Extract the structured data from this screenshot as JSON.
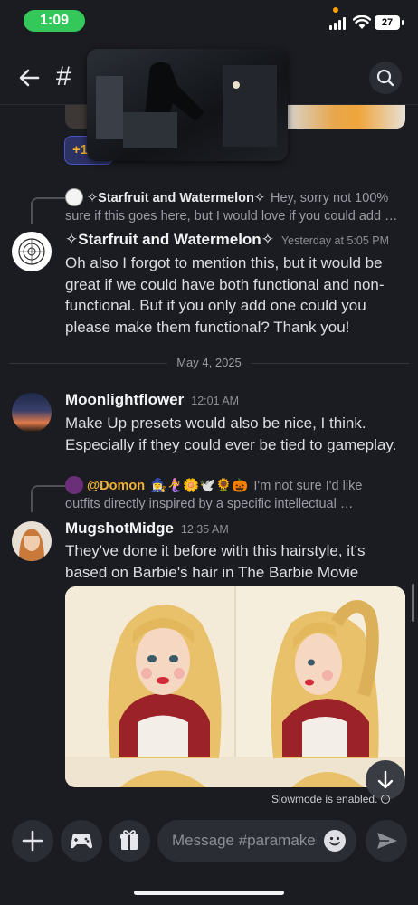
{
  "status_bar": {
    "time": "1:09",
    "battery": "27"
  },
  "header": {
    "hash": "#"
  },
  "reaction": {
    "label": "+1"
  },
  "messages": [
    {
      "reply": {
        "author": "✧Starfruit and Watermelon✧",
        "text_line1": "Hey, sorry not 100%",
        "text_line2": "sure if this goes here, but I would love if you could add …"
      },
      "author": "✧Starfruit and Watermelon✧",
      "timestamp": "Yesterday at 5:05 PM",
      "text": "Oh also I forgot to mention this, but it would be great if we could have both functional and non-functional. But if you only add one could you please make them functional? Thank you!"
    },
    {
      "author": "Moonlightflower",
      "timestamp": "12:01 AM",
      "text": "Make Up presets would also be nice, I think. Especially if they could ever be tied to gameplay."
    },
    {
      "reply": {
        "author": "@Domon",
        "emojis": "🧙‍♀️🧜‍♀️🌼🕊️🌻🎃",
        "text_line1": "I'm not sure I'd like",
        "text_line2": "outfits directly inspired by a specific intellectual …"
      },
      "author": "MugshotMidge",
      "timestamp": "12:35 AM",
      "text": "They've done it before with this hairstyle, it's based on Barbie's hair in The Barbie Movie"
    }
  ],
  "date_divider": "May 4, 2025",
  "slowmode": "Slowmode is enabled.",
  "composer": {
    "placeholder": "Message #paramaker"
  },
  "colors": {
    "status_green": "#34c759",
    "reply_orange": "#f0b232",
    "background": "#1b1c21"
  },
  "icons": [
    "back-arrow-icon",
    "hash-icon",
    "search-icon",
    "plus-icon",
    "gamepad-icon",
    "gift-icon",
    "emoji-icon",
    "send-icon",
    "chevron-down-icon",
    "clock-icon"
  ]
}
